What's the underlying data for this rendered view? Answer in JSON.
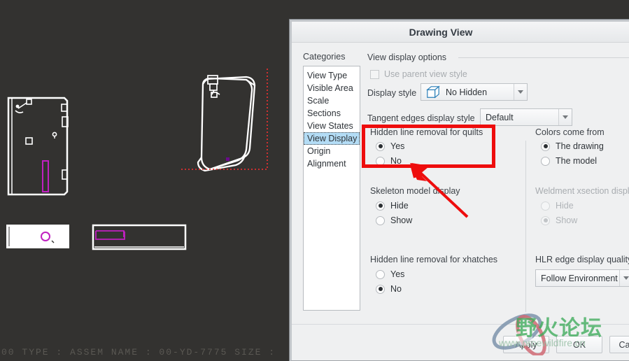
{
  "status_bar": {
    "text": "00   TYPE : ASSEM  NAME : 00-YD-7775  SIZE : "
  },
  "dialog": {
    "title": "Drawing View",
    "categories_label": "Categories",
    "categories": [
      {
        "label": "View Type",
        "selected": false
      },
      {
        "label": "Visible Area",
        "selected": false
      },
      {
        "label": "Scale",
        "selected": false
      },
      {
        "label": "Sections",
        "selected": false
      },
      {
        "label": "View States",
        "selected": false
      },
      {
        "label": "View Display",
        "selected": true
      },
      {
        "label": "Origin",
        "selected": false
      },
      {
        "label": "Alignment",
        "selected": false
      }
    ],
    "view_display_options": {
      "group_title": "View display options",
      "use_parent_view_style": {
        "label": "Use parent view style",
        "checked": false,
        "enabled": false
      },
      "display_style": {
        "label": "Display style",
        "value": "No Hidden",
        "icon": "cube-icon"
      },
      "tangent_edges": {
        "label": "Tangent edges display style",
        "value": "Default"
      }
    },
    "hidden_line_quilts": {
      "title": "Hidden line removal for quilts",
      "options": [
        {
          "label": "Yes",
          "selected": true
        },
        {
          "label": "No",
          "selected": false
        }
      ]
    },
    "skeleton_model_display": {
      "title": "Skeleton model display",
      "options": [
        {
          "label": "Hide",
          "selected": true
        },
        {
          "label": "Show",
          "selected": false
        }
      ]
    },
    "hidden_line_xhatches": {
      "title": "Hidden line removal for xhatches",
      "options": [
        {
          "label": "Yes",
          "selected": false
        },
        {
          "label": "No",
          "selected": true
        }
      ]
    },
    "colors_come_from": {
      "title": "Colors come from",
      "options": [
        {
          "label": "The drawing",
          "selected": true
        },
        {
          "label": "The model",
          "selected": false
        }
      ]
    },
    "weldment_xsection_display": {
      "title": "Weldment xsection display",
      "enabled": false,
      "options": [
        {
          "label": "Hide",
          "selected": false
        },
        {
          "label": "Show",
          "selected": true
        }
      ]
    },
    "hlr_edge_display_quality": {
      "title": "HLR edge display quality",
      "value": "Follow Environment"
    },
    "buttons": {
      "apply": "Apply",
      "ok": "OK",
      "cancel": "Cancel"
    }
  },
  "annotations": {
    "highlight_color": "#ee0d0d",
    "arrow_color": "#ee0d0d"
  },
  "watermark": {
    "text": "野火论坛",
    "url": "www.proewildfire.cn"
  },
  "canvas": {
    "background": "#333230",
    "line_color": "#ffffff",
    "accent_color": "#c020c0",
    "selection_color": "#e03030"
  }
}
